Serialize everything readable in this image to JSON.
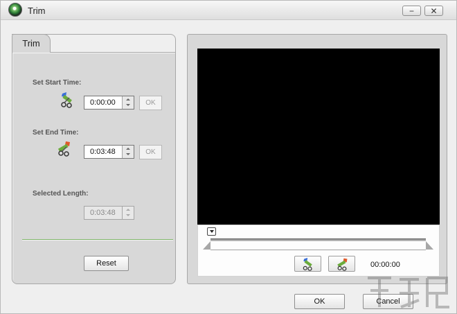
{
  "window": {
    "title": "Trim",
    "minimize_glyph": "−",
    "close_glyph": "✕"
  },
  "left_panel": {
    "tab_label": "Trim",
    "start": {
      "label": "Set Start Time:",
      "value": "0:00:00",
      "ok_label": "OK",
      "icon": "scissors-start-icon"
    },
    "end": {
      "label": "Set End Time:",
      "value": "0:03:48",
      "ok_label": "OK",
      "icon": "scissors-end-icon"
    },
    "length": {
      "label": "Selected Length:",
      "value": "0:03:48"
    },
    "reset_label": "Reset"
  },
  "player": {
    "time": "00:00:00",
    "progress": 0,
    "buttons": [
      {
        "name": "set-start-marker-button",
        "icon": "scissors-start-icon"
      },
      {
        "name": "set-end-marker-button",
        "icon": "scissors-end-icon"
      }
    ]
  },
  "footer": {
    "ok_label": "OK",
    "cancel_label": "Cancel"
  },
  "colors": {
    "video_bg": "#000000",
    "divider": "#7fb56a",
    "panel": "#d8d8d8"
  }
}
